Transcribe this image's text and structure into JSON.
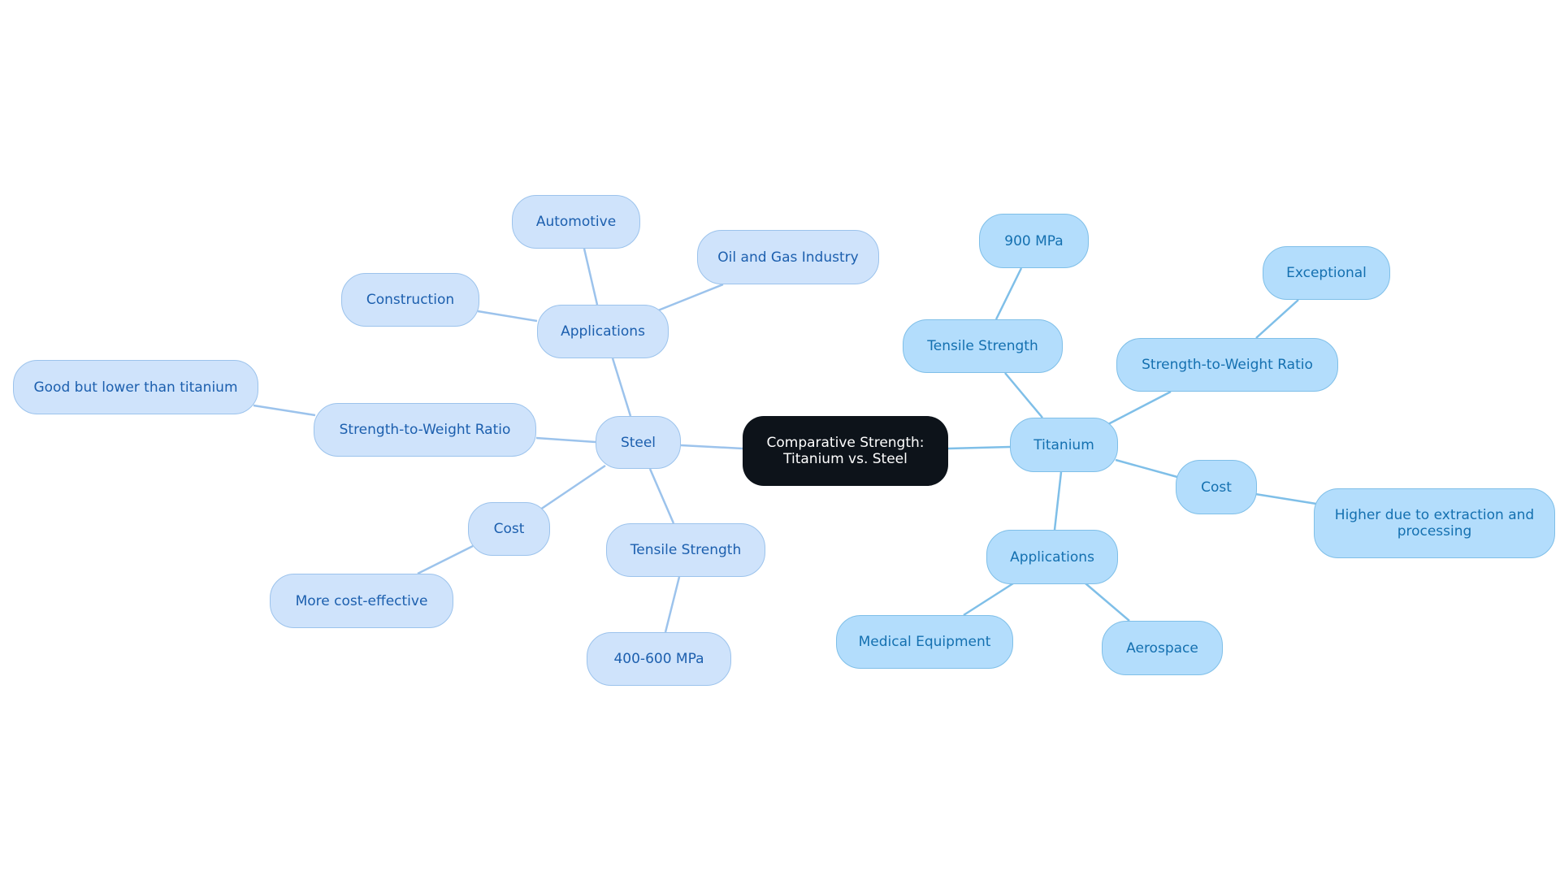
{
  "diagram": {
    "type": "mind-map",
    "root": {
      "label": "Comparative Strength: Titanium vs. Steel"
    },
    "colors": {
      "root_bg": "#0d131a",
      "steel_bg": "#cfe3fb",
      "steel_text": "#1c5fae",
      "titanium_bg": "#b3ddfc",
      "titanium_text": "#1470b0",
      "edge_steel": "#9cc3ec",
      "edge_titanium": "#7fbfe8"
    },
    "steel": {
      "label": "Steel",
      "applications": {
        "label": "Applications",
        "items": [
          "Automotive",
          "Oil and Gas Industry",
          "Construction"
        ]
      },
      "strength_to_weight": {
        "label": "Strength-to-Weight Ratio",
        "value": "Good but lower than titanium"
      },
      "cost": {
        "label": "Cost",
        "value": "More cost-effective"
      },
      "tensile": {
        "label": "Tensile Strength",
        "value": "400-600 MPa"
      }
    },
    "titanium": {
      "label": "Titanium",
      "tensile": {
        "label": "Tensile Strength",
        "value": "900 MPa"
      },
      "strength_to_weight": {
        "label": "Strength-to-Weight Ratio",
        "value": "Exceptional"
      },
      "cost": {
        "label": "Cost",
        "value": "Higher due to extraction and processing"
      },
      "applications": {
        "label": "Applications",
        "items": [
          "Medical Equipment",
          "Aerospace"
        ]
      }
    }
  }
}
